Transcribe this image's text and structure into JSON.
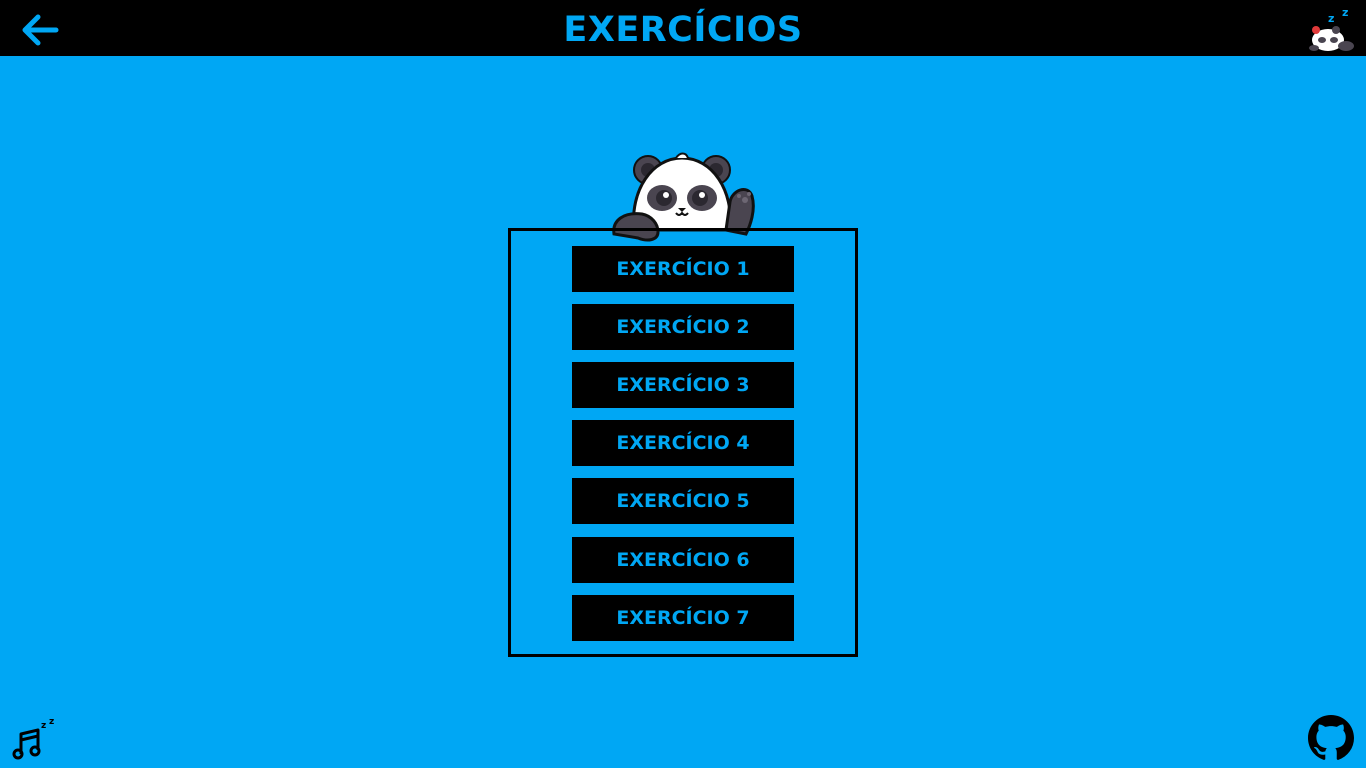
{
  "header": {
    "title": "EXERCÍCIOS",
    "back_icon": "arrow-left-icon",
    "right_icon": "sleeping-panda-icon"
  },
  "mascot": {
    "icon": "waving-panda-illustration"
  },
  "exercises": [
    {
      "label": "EXERCÍCIO 1"
    },
    {
      "label": "EXERCÍCIO 2"
    },
    {
      "label": "EXERCÍCIO 3"
    },
    {
      "label": "EXERCÍCIO 4"
    },
    {
      "label": "EXERCÍCIO 5"
    },
    {
      "label": "EXERCÍCIO 6"
    },
    {
      "label": "EXERCÍCIO 7"
    }
  ],
  "footer": {
    "left_icon": "music-note-sleep-icon",
    "right_icon": "github-icon"
  },
  "colors": {
    "background": "#00a7f4",
    "bar": "#000000",
    "accent": "#00a7f4"
  }
}
